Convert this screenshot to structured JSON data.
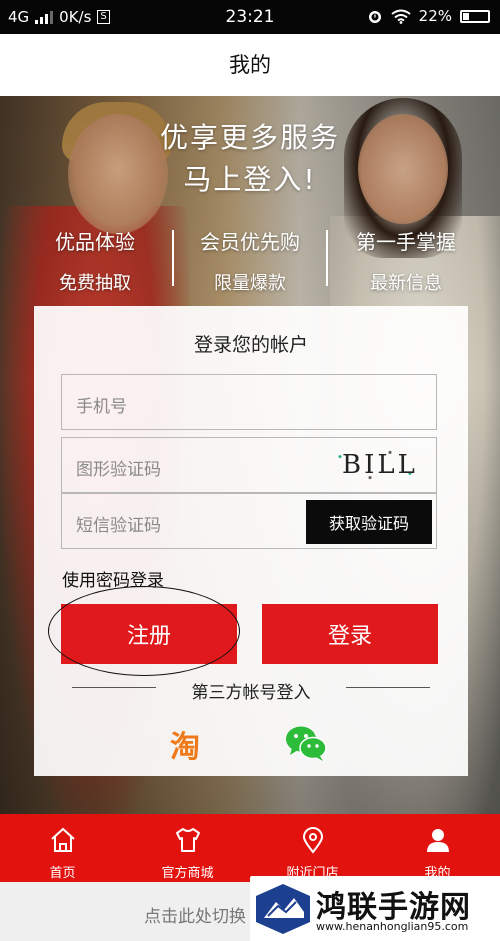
{
  "status_bar": {
    "network": "4G",
    "speed": "0K/s",
    "time": "23:21",
    "battery": "22%"
  },
  "header": {
    "title": "我的"
  },
  "promo": {
    "line1": "优享更多服务",
    "line2": "马上登入!",
    "perks": [
      {
        "title": "优品体验",
        "sub": "免费抽取"
      },
      {
        "title": "会员优先购",
        "sub": "限量爆款"
      },
      {
        "title": "第一手掌握",
        "sub": "最新信息"
      }
    ]
  },
  "login": {
    "title": "登录您的帐户",
    "phone_placeholder": "手机号",
    "captcha_placeholder": "图形验证码",
    "captcha_text": "BILL",
    "sms_placeholder": "短信验证码",
    "sms_button": "获取验证码",
    "password_login": "使用密码登录",
    "register_button": "注册",
    "login_button": "登录",
    "third_party": "第三方帐号登入",
    "taobao_icon": "淘"
  },
  "nav": {
    "items": [
      {
        "label": "首页",
        "icon": "home-icon"
      },
      {
        "label": "官方商城",
        "icon": "shirt-icon"
      },
      {
        "label": "附近门店",
        "icon": "location-pin-icon"
      },
      {
        "label": "我的",
        "icon": "user-icon"
      }
    ]
  },
  "footer": {
    "text": "点击此处切换"
  },
  "watermark": {
    "name": "鸿联手游网",
    "url": "www.henanhonglian95.com"
  },
  "colors": {
    "brand_red": "#e0191c",
    "nav_red": "#e2130f",
    "wechat_green": "#2dbb3a",
    "taobao_orange": "#f07a1a"
  }
}
